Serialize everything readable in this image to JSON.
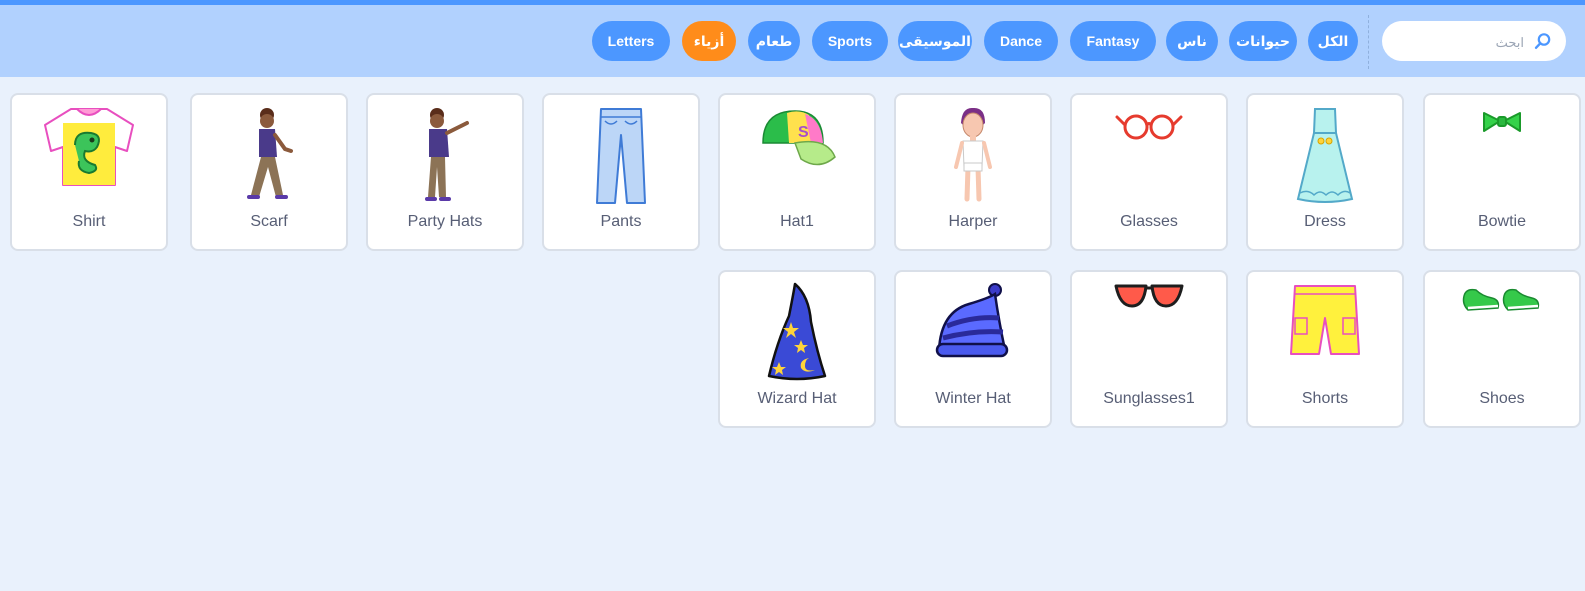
{
  "search": {
    "placeholder": "ابحث",
    "value": ""
  },
  "tags": [
    {
      "label": "الكل",
      "active": false
    },
    {
      "label": "حيوانات",
      "active": false
    },
    {
      "label": "ناس",
      "active": false
    },
    {
      "label": "Fantasy",
      "active": false
    },
    {
      "label": "Dance",
      "active": false
    },
    {
      "label": "الموسيقى",
      "active": false
    },
    {
      "label": "Sports",
      "active": false
    },
    {
      "label": "طعام",
      "active": false
    },
    {
      "label": "أزياء",
      "active": true
    },
    {
      "label": "Letters",
      "active": false
    }
  ],
  "items": [
    {
      "name": "Bowtie",
      "icon": "bowtie-icon"
    },
    {
      "name": "Dress",
      "icon": "dress-icon"
    },
    {
      "name": "Glasses",
      "icon": "glasses-icon"
    },
    {
      "name": "Harper",
      "icon": "harper-icon"
    },
    {
      "name": "Hat1",
      "icon": "cap-icon"
    },
    {
      "name": "Pants",
      "icon": "pants-icon"
    },
    {
      "name": "Party Hats",
      "icon": "party-hats-icon"
    },
    {
      "name": "Scarf",
      "icon": "scarf-icon"
    },
    {
      "name": "Shirt",
      "icon": "shirt-icon"
    },
    {
      "name": "Shoes",
      "icon": "shoes-icon"
    },
    {
      "name": "Shorts",
      "icon": "shorts-icon"
    },
    {
      "name": "Sunglasses1",
      "icon": "sunglasses-icon"
    },
    {
      "name": "Winter Hat",
      "icon": "winter-hat-icon"
    },
    {
      "name": "Wizard Hat",
      "icon": "wizard-hat-icon"
    }
  ]
}
